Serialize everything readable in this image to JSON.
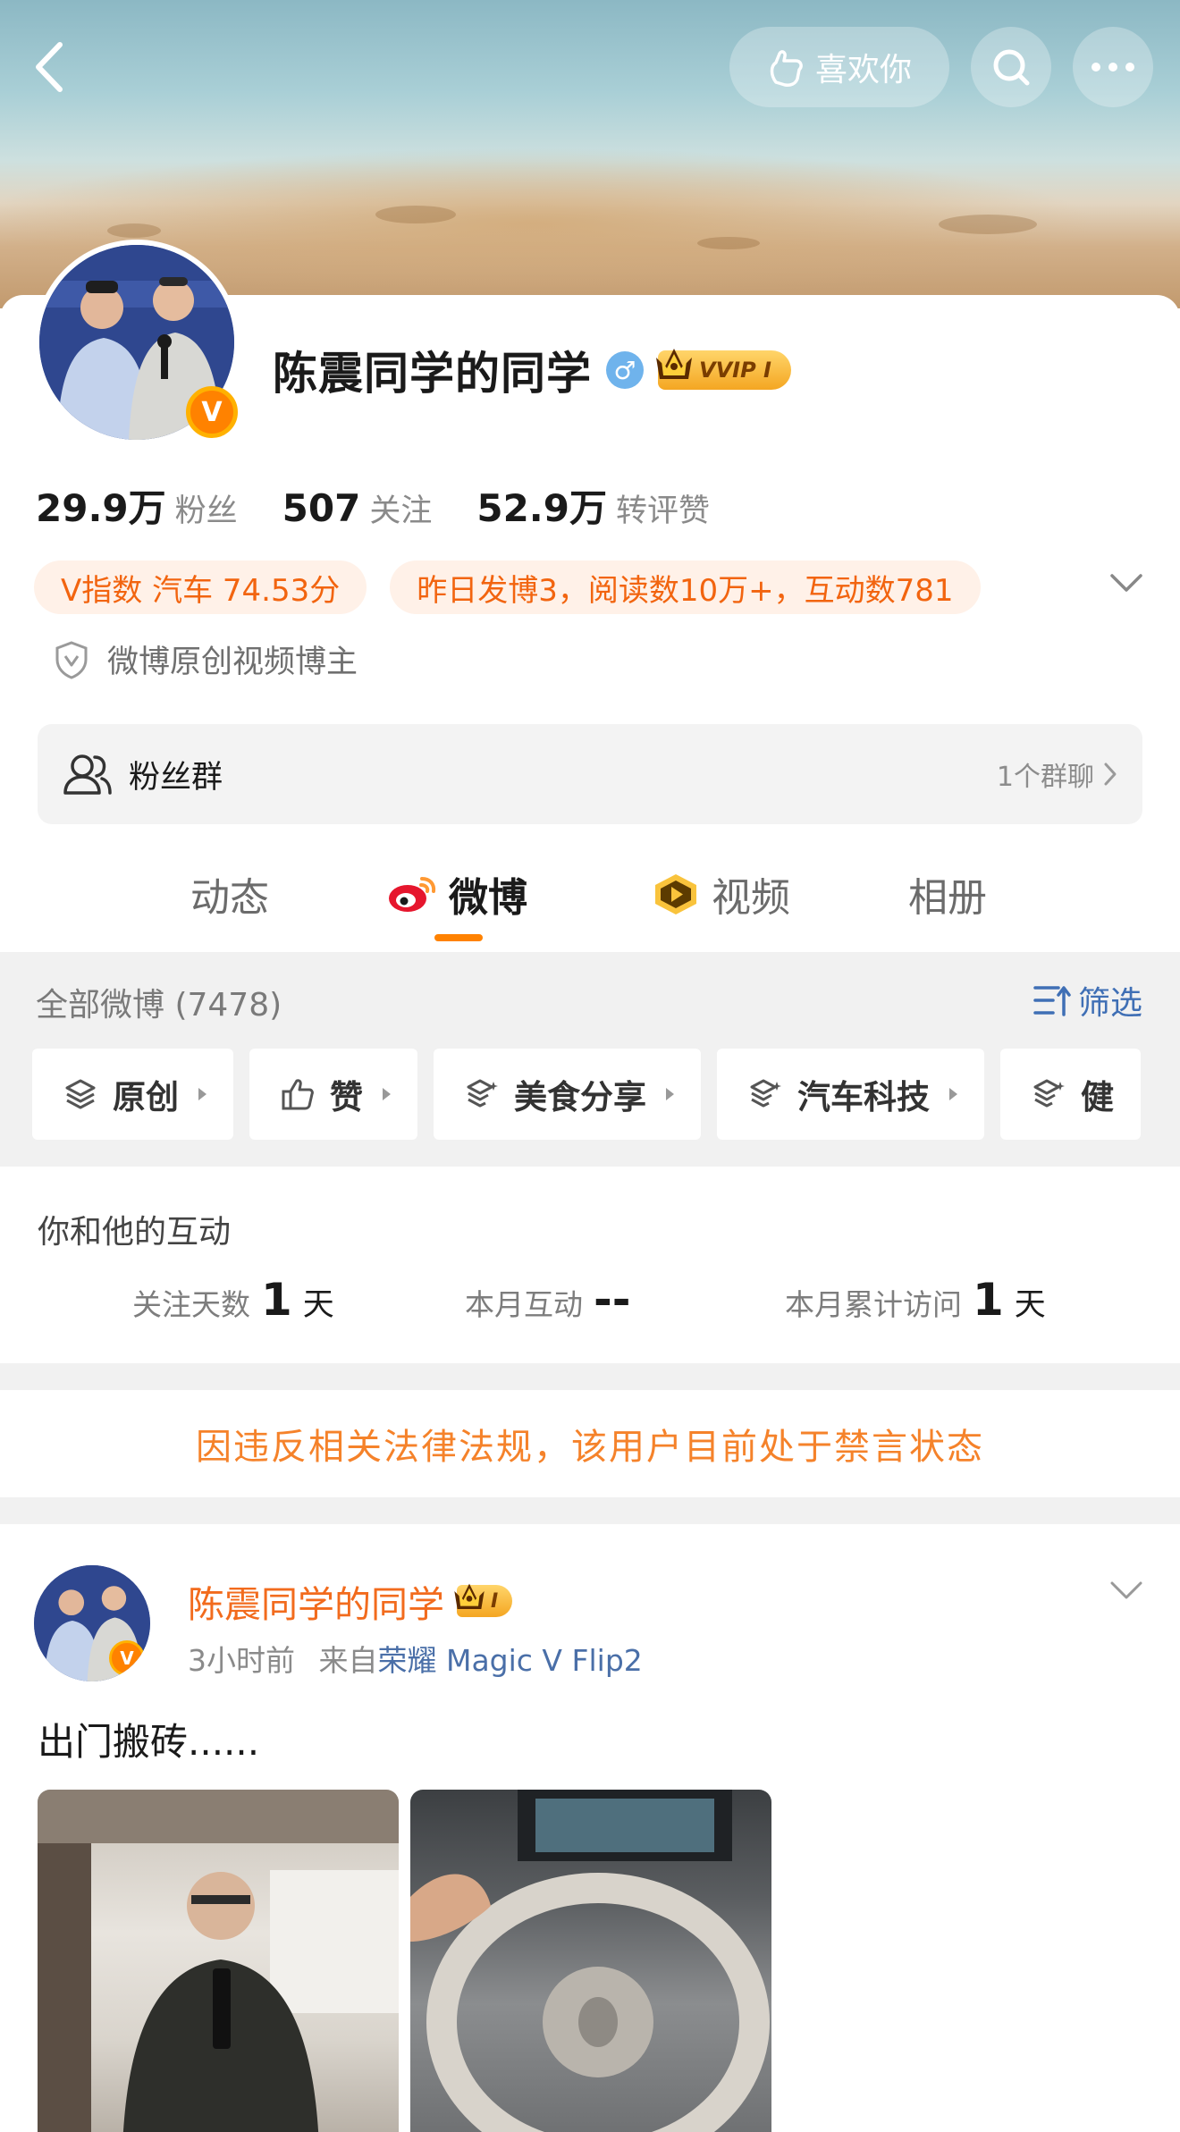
{
  "header": {
    "like_label": "喜欢你"
  },
  "profile": {
    "name": "陈震同学的同学",
    "vip_label": "VVIP I",
    "verified_badge": "V",
    "gender_symbol": "♂",
    "stats": [
      {
        "value": "29.9万",
        "label": "粉丝"
      },
      {
        "value": "507",
        "label": "关注"
      },
      {
        "value": "52.9万",
        "label": "转评赞"
      }
    ],
    "tags": [
      "V指数 汽车 74.53分",
      "昨日发博3，阅读数10万+，互动数781"
    ],
    "certification": "微博原创视频博主"
  },
  "fan_group": {
    "label": "粉丝群",
    "count": "1个群聊"
  },
  "tabs": [
    {
      "label": "动态"
    },
    {
      "label": "微博"
    },
    {
      "label": "视频"
    },
    {
      "label": "相册"
    }
  ],
  "feed": {
    "all_label": "全部微博 (7478)",
    "filter_label": "筛选",
    "chips": [
      "原创",
      "赞",
      "美食分享",
      "汽车科技",
      "健"
    ]
  },
  "interaction": {
    "title": "你和他的互动",
    "items": [
      {
        "label": "关注天数",
        "value": "1",
        "unit": "天"
      },
      {
        "label": "本月互动",
        "value": "--",
        "unit": ""
      },
      {
        "label": "本月累计访问",
        "value": "1",
        "unit": "天"
      }
    ]
  },
  "notice": "因违反相关法律法规，该用户目前处于禁言状态",
  "post": {
    "author": "陈震同学的同学",
    "vip_label": "I",
    "time": "3小时前",
    "source_prefix": "来自",
    "source": "荣耀 Magic V Flip2",
    "text": "出门搬砖......"
  },
  "colors": {
    "accent": "#ff8200",
    "tag_text": "#f2640f",
    "link_blue": "#3f6fb5",
    "notice": "#f5822a"
  }
}
